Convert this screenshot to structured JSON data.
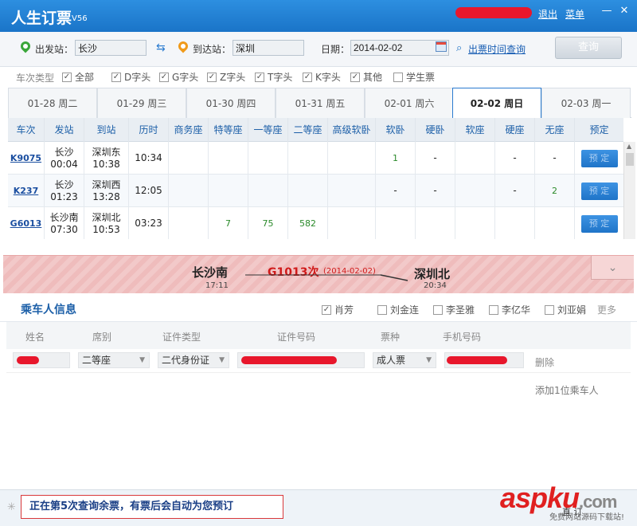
{
  "titlebar": {
    "app_title": "人生订票",
    "version": "V56",
    "logout": "退出",
    "menu": "菜单",
    "minimize": "—",
    "close": "✕"
  },
  "search": {
    "from_label": "出发站：",
    "from_value": "长沙",
    "to_label": "到达站：",
    "to_value": "深圳",
    "date_label": "日期：",
    "date_value": "2014-02-02",
    "time_query_link": "出票时间查询",
    "query_button": "查询"
  },
  "filters": {
    "label": "车次类型",
    "items": [
      {
        "label": "全部",
        "checked": true
      },
      {
        "label": "D字头",
        "checked": true
      },
      {
        "label": "G字头",
        "checked": true
      },
      {
        "label": "Z字头",
        "checked": true
      },
      {
        "label": "T字头",
        "checked": true
      },
      {
        "label": "K字头",
        "checked": true
      },
      {
        "label": "其他",
        "checked": true
      },
      {
        "label": "学生票",
        "checked": false
      }
    ]
  },
  "date_tabs": [
    {
      "label": "01-28 周二",
      "active": false
    },
    {
      "label": "01-29 周三",
      "active": false
    },
    {
      "label": "01-30 周四",
      "active": false
    },
    {
      "label": "01-31 周五",
      "active": false
    },
    {
      "label": "02-01 周六",
      "active": false
    },
    {
      "label": "02-02 周日",
      "active": true
    },
    {
      "label": "02-03 周一",
      "active": false
    }
  ],
  "table": {
    "headers": [
      "车次",
      "发站",
      "到站",
      "历时",
      "商务座",
      "特等座",
      "一等座",
      "二等座",
      "高级软卧",
      "软卧",
      "硬卧",
      "软座",
      "硬座",
      "无座",
      "预定"
    ],
    "rows": [
      {
        "train": "K9075",
        "from": "长沙",
        "from_time": "00:04",
        "to": "深圳东",
        "to_time": "10:38",
        "duration": "10:34",
        "business": "",
        "special": "",
        "first": "",
        "second": "",
        "adv_soft_sleeper": "",
        "soft_sleeper": "1",
        "hard_sleeper": "-",
        "soft_seat": "",
        "hard_seat": "-",
        "no_seat": "-",
        "book": "预 定"
      },
      {
        "train": "K237",
        "from": "长沙",
        "from_time": "01:23",
        "to": "深圳西",
        "to_time": "13:28",
        "duration": "12:05",
        "business": "",
        "special": "",
        "first": "",
        "second": "",
        "adv_soft_sleeper": "",
        "soft_sleeper": "-",
        "hard_sleeper": "-",
        "soft_seat": "",
        "hard_seat": "-",
        "no_seat": "2",
        "book": "预 定"
      },
      {
        "train": "G6013",
        "from": "长沙南",
        "from_time": "07:30",
        "to": "深圳北",
        "to_time": "10:53",
        "duration": "03:23",
        "business": "",
        "special": "7",
        "first": "75",
        "second": "582",
        "adv_soft_sleeper": "",
        "soft_sleeper": "",
        "hard_sleeper": "",
        "soft_seat": "",
        "hard_seat": "",
        "no_seat": "",
        "book": "预 定"
      }
    ]
  },
  "banner": {
    "from": "长沙南",
    "from_time": "17:11",
    "train": "G1013次",
    "date": "(2014-02-02)",
    "to": "深圳北",
    "to_time": "20:34",
    "collapse": "⌄"
  },
  "passengers": {
    "title": "乘车人信息",
    "contacts": [
      {
        "name": "肖芳",
        "checked": true
      },
      {
        "name": "刘金连",
        "checked": false
      },
      {
        "name": "李圣雅",
        "checked": false
      },
      {
        "name": "李亿华",
        "checked": false
      },
      {
        "name": "刘亚娟",
        "checked": false
      }
    ],
    "more": "更多",
    "headers": {
      "name": "姓名",
      "seat": "席别",
      "id_type": "证件类型",
      "id_number": "证件号码",
      "ticket_type": "票种",
      "phone": "手机号码"
    },
    "row": {
      "seat": "二等座",
      "id_type": "二代身份证",
      "ticket_type": "成人票",
      "delete": "删除"
    },
    "add_one": "添加1位乘车人"
  },
  "status": {
    "message": "正在第5次查询余票，有票后会自动为您预订",
    "spinner": "✳"
  },
  "watermark": {
    "brand": "aspku",
    "suffix": ".com",
    "sub": "免费网站源码下载站!"
  },
  "colors": {
    "title_bar": "#1a74c8",
    "accent_blue": "#1c5fa8",
    "redaction": "#e8172c",
    "green_count": "#2a8a2a",
    "train_red": "#d01a1a"
  }
}
